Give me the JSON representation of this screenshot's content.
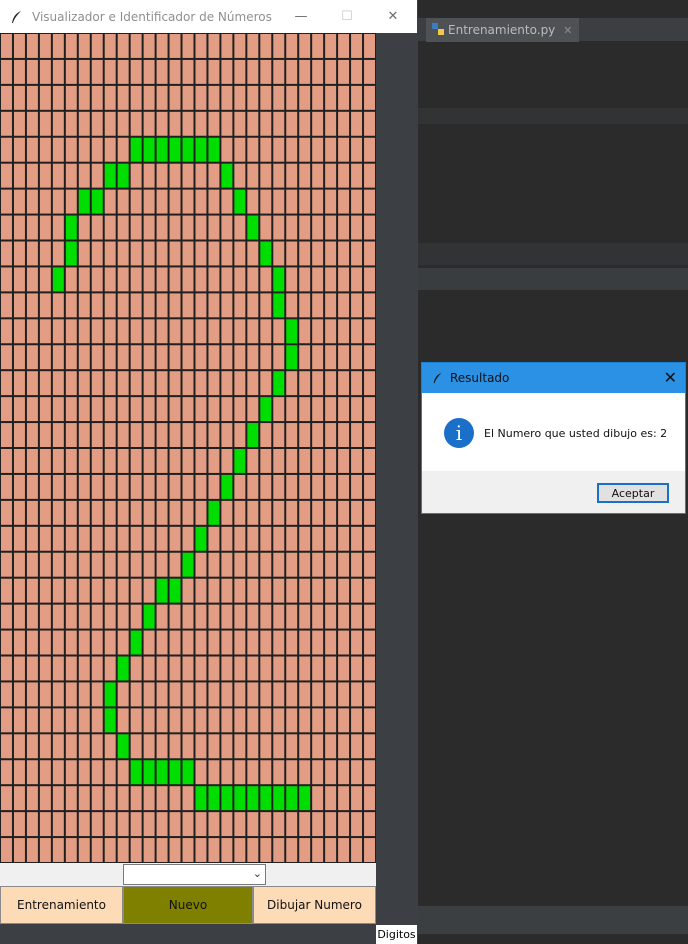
{
  "main_window": {
    "title": "Visualizador e Identificador de Números",
    "minimize_glyph": "—",
    "maximize_glyph": "☐",
    "close_glyph": "✕"
  },
  "grid": {
    "cols": 29,
    "rows": 32,
    "off_color": "#e39d85",
    "on_color": "#00dd00",
    "on_cells": [
      [
        4,
        10
      ],
      [
        4,
        11
      ],
      [
        4,
        12
      ],
      [
        4,
        13
      ],
      [
        4,
        14
      ],
      [
        4,
        15
      ],
      [
        4,
        16
      ],
      [
        5,
        8
      ],
      [
        5,
        9
      ],
      [
        5,
        17
      ],
      [
        6,
        6
      ],
      [
        6,
        7
      ],
      [
        6,
        18
      ],
      [
        7,
        5
      ],
      [
        7,
        19
      ],
      [
        8,
        5
      ],
      [
        8,
        20
      ],
      [
        9,
        4
      ],
      [
        9,
        21
      ],
      [
        10,
        21
      ],
      [
        11,
        22
      ],
      [
        12,
        22
      ],
      [
        13,
        21
      ],
      [
        14,
        20
      ],
      [
        15,
        19
      ],
      [
        16,
        18
      ],
      [
        17,
        17
      ],
      [
        18,
        16
      ],
      [
        19,
        15
      ],
      [
        20,
        14
      ],
      [
        21,
        12
      ],
      [
        21,
        13
      ],
      [
        22,
        11
      ],
      [
        23,
        10
      ],
      [
        24,
        9
      ],
      [
        25,
        8
      ],
      [
        26,
        8
      ],
      [
        27,
        9
      ],
      [
        28,
        10
      ],
      [
        28,
        11
      ],
      [
        28,
        12
      ],
      [
        28,
        13
      ],
      [
        28,
        14
      ],
      [
        29,
        15
      ],
      [
        29,
        16
      ],
      [
        29,
        17
      ],
      [
        29,
        18
      ],
      [
        29,
        19
      ],
      [
        29,
        20
      ],
      [
        29,
        21
      ],
      [
        29,
        22
      ],
      [
        29,
        23
      ]
    ]
  },
  "combo": {
    "value": "",
    "arrow_glyph": "⌄"
  },
  "buttons": {
    "train": "Entrenamiento",
    "new": "Nuevo",
    "draw": "Dibujar Numero"
  },
  "status_label": "Digitos",
  "ide": {
    "tab_label": "Entrenamiento.py",
    "tab_close": "✕"
  },
  "dialog": {
    "title": "Resultado",
    "close_glyph": "✕",
    "info_glyph": "i",
    "message": "El Numero que usted dibujo es: 2",
    "ok_label": "Aceptar"
  },
  "colors": {
    "button_light": "#fddbb6",
    "button_active": "#808000",
    "dialog_title": "#2b91e5"
  }
}
